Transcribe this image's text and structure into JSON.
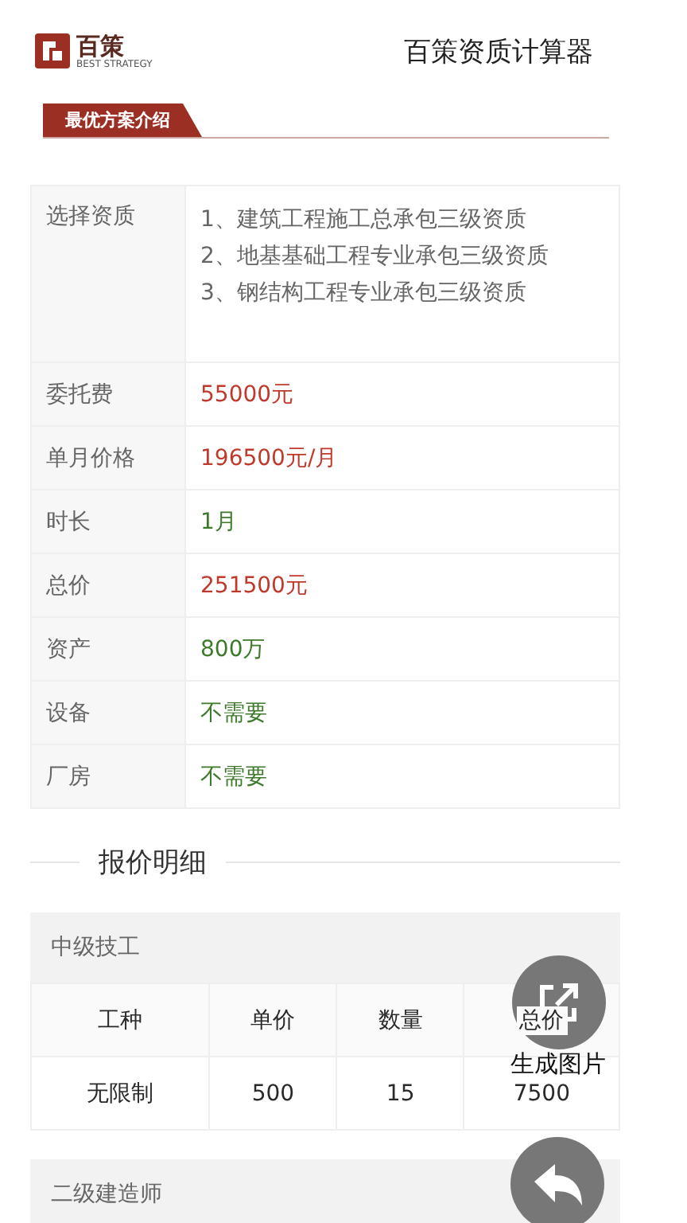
{
  "header": {
    "brand": "百策",
    "brand_sub": "BEST STRATEGY",
    "title": "百策资质计算器"
  },
  "summary": {
    "title": "最优方案介绍",
    "rows": [
      {
        "kind": "list",
        "label": "选择资质",
        "lines": [
          "1、建筑工程施工总承包三级资质",
          "2、地基基础工程专业承包三级资质",
          "3、钢结构工程专业承包三级资质"
        ]
      },
      {
        "kind": "value",
        "label": "委托费",
        "value": "55000元",
        "color": "#c0392b"
      },
      {
        "kind": "value",
        "label": "单月价格",
        "value": "196500元/月",
        "color": "#c0392b"
      },
      {
        "kind": "value",
        "label": "时长",
        "value": "1月",
        "color": "#3d7a2a"
      },
      {
        "kind": "value",
        "label": "总价",
        "value": "251500元",
        "color": "#c0392b"
      },
      {
        "kind": "value",
        "label": "资产",
        "value": "800万",
        "color": "#3d7a2a"
      },
      {
        "kind": "value",
        "label": "设备",
        "value": "不需要",
        "color": "#3d7a2a"
      },
      {
        "kind": "value",
        "label": "厂房",
        "value": "不需要",
        "color": "#3d7a2a"
      }
    ]
  },
  "details": {
    "title": "报价明细",
    "groups": [
      {
        "name": "中级技工",
        "columns": [
          "工种",
          "单价",
          "数量",
          "总价"
        ],
        "rows": [
          [
            "无限制",
            "500",
            "15",
            "7500"
          ]
        ]
      },
      {
        "name": "二级建造师"
      }
    ]
  },
  "actions": [
    {
      "kind": "share",
      "label": "生成图片"
    },
    {
      "kind": "back"
    }
  ]
}
